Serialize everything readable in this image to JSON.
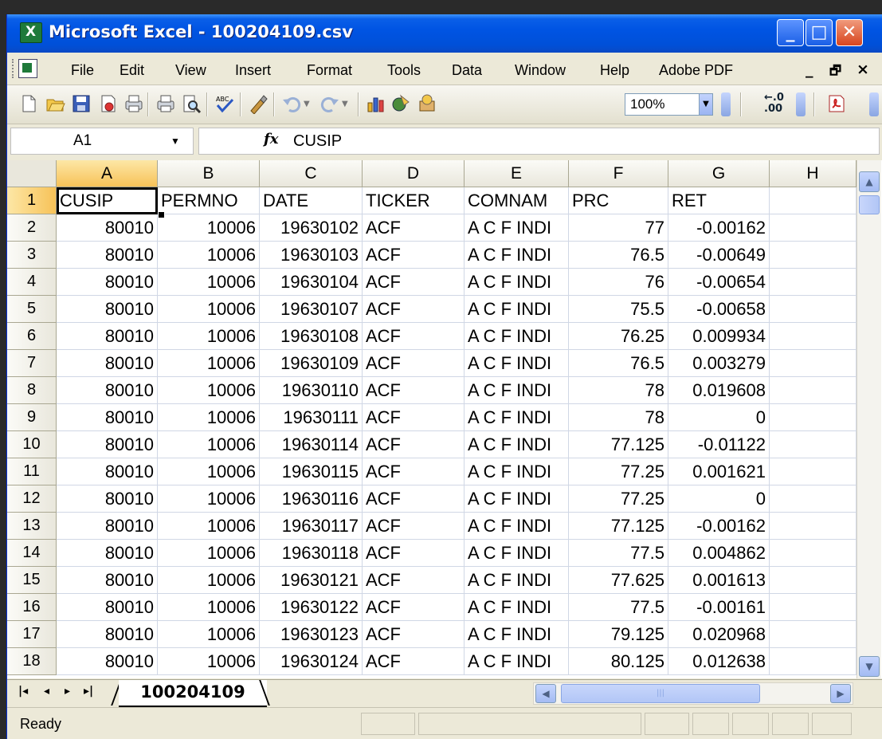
{
  "window": {
    "title": "Microsoft Excel - 100204109.csv",
    "controls": {
      "minimize": "_",
      "maximize": "□",
      "close": "✕"
    }
  },
  "menu": [
    "File",
    "Edit",
    "View",
    "Insert",
    "Format",
    "Tools",
    "Data",
    "Window",
    "Help",
    "Adobe PDF"
  ],
  "menu_doc_controls": {
    "minimize": "_",
    "restore": "🗗",
    "close": "×"
  },
  "toolbar": {
    "icons": [
      "new-icon",
      "open-icon",
      "save-icon",
      "permission-icon",
      "print-area-icon",
      "print-icon",
      "print-preview-icon",
      "spelling-icon",
      "research-icon",
      "undo-icon",
      "redo-icon",
      "chart-wizard-icon",
      "drawing-icon",
      "microsoft-excel-help-icon"
    ],
    "zoom": "100%",
    "decrease_decimal": "←.0\n.00"
  },
  "formula_bar": {
    "name_box": "A1",
    "fx": "fx",
    "value": "CUSIP"
  },
  "sheet": {
    "columns": [
      "A",
      "B",
      "C",
      "D",
      "E",
      "F",
      "G",
      "H"
    ],
    "selected_column": "A",
    "selected_row": 1,
    "active_cell": "A1",
    "header_row": [
      "CUSIP",
      "PERMNO",
      "DATE",
      "TICKER",
      "COMNAM",
      "PRC",
      "RET"
    ],
    "rows": [
      {
        "n": "2",
        "cusip": "80010",
        "permno": "10006",
        "date": "19630102",
        "ticker": "ACF",
        "comnam": "A C F INDI",
        "prc": "77",
        "ret": "-0.00162"
      },
      {
        "n": "3",
        "cusip": "80010",
        "permno": "10006",
        "date": "19630103",
        "ticker": "ACF",
        "comnam": "A C F INDI",
        "prc": "76.5",
        "ret": "-0.00649"
      },
      {
        "n": "4",
        "cusip": "80010",
        "permno": "10006",
        "date": "19630104",
        "ticker": "ACF",
        "comnam": "A C F INDI",
        "prc": "76",
        "ret": "-0.00654"
      },
      {
        "n": "5",
        "cusip": "80010",
        "permno": "10006",
        "date": "19630107",
        "ticker": "ACF",
        "comnam": "A C F INDI",
        "prc": "75.5",
        "ret": "-0.00658"
      },
      {
        "n": "6",
        "cusip": "80010",
        "permno": "10006",
        "date": "19630108",
        "ticker": "ACF",
        "comnam": "A C F INDI",
        "prc": "76.25",
        "ret": "0.009934"
      },
      {
        "n": "7",
        "cusip": "80010",
        "permno": "10006",
        "date": "19630109",
        "ticker": "ACF",
        "comnam": "A C F INDI",
        "prc": "76.5",
        "ret": "0.003279"
      },
      {
        "n": "8",
        "cusip": "80010",
        "permno": "10006",
        "date": "19630110",
        "ticker": "ACF",
        "comnam": "A C F INDI",
        "prc": "78",
        "ret": "0.019608"
      },
      {
        "n": "9",
        "cusip": "80010",
        "permno": "10006",
        "date": "19630111",
        "ticker": "ACF",
        "comnam": "A C F INDI",
        "prc": "78",
        "ret": "0"
      },
      {
        "n": "10",
        "cusip": "80010",
        "permno": "10006",
        "date": "19630114",
        "ticker": "ACF",
        "comnam": "A C F INDI",
        "prc": "77.125",
        "ret": "-0.01122"
      },
      {
        "n": "11",
        "cusip": "80010",
        "permno": "10006",
        "date": "19630115",
        "ticker": "ACF",
        "comnam": "A C F INDI",
        "prc": "77.25",
        "ret": "0.001621"
      },
      {
        "n": "12",
        "cusip": "80010",
        "permno": "10006",
        "date": "19630116",
        "ticker": "ACF",
        "comnam": "A C F INDI",
        "prc": "77.25",
        "ret": "0"
      },
      {
        "n": "13",
        "cusip": "80010",
        "permno": "10006",
        "date": "19630117",
        "ticker": "ACF",
        "comnam": "A C F INDI",
        "prc": "77.125",
        "ret": "-0.00162"
      },
      {
        "n": "14",
        "cusip": "80010",
        "permno": "10006",
        "date": "19630118",
        "ticker": "ACF",
        "comnam": "A C F INDI",
        "prc": "77.5",
        "ret": "0.004862"
      },
      {
        "n": "15",
        "cusip": "80010",
        "permno": "10006",
        "date": "19630121",
        "ticker": "ACF",
        "comnam": "A C F INDI",
        "prc": "77.625",
        "ret": "0.001613"
      },
      {
        "n": "16",
        "cusip": "80010",
        "permno": "10006",
        "date": "19630122",
        "ticker": "ACF",
        "comnam": "A C F INDI",
        "prc": "77.5",
        "ret": "-0.00161"
      },
      {
        "n": "17",
        "cusip": "80010",
        "permno": "10006",
        "date": "19630123",
        "ticker": "ACF",
        "comnam": "A C F INDI",
        "prc": "79.125",
        "ret": "0.020968"
      },
      {
        "n": "18",
        "cusip": "80010",
        "permno": "10006",
        "date": "19630124",
        "ticker": "ACF",
        "comnam": "A C F INDI",
        "prc": "80.125",
        "ret": "0.012638"
      }
    ]
  },
  "sheet_tabs": {
    "nav": [
      "|◂",
      "◂",
      "▸",
      "▸|"
    ],
    "active": "100204109"
  },
  "status": {
    "text": "Ready"
  },
  "colors": {
    "titlebar": "#0054e3",
    "selected_header": "#f7c258",
    "chrome": "#ece9d8"
  }
}
